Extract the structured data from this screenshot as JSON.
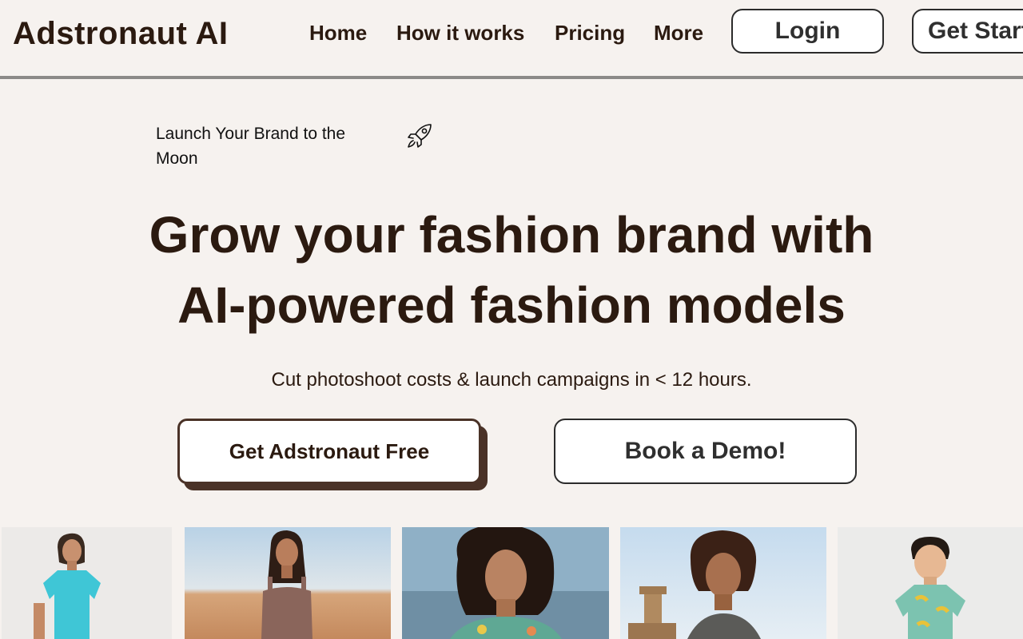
{
  "header": {
    "logo": "Adstronaut AI",
    "nav": [
      "Home",
      "How it works",
      "Pricing",
      "More"
    ],
    "login_label": "Login",
    "get_started_label": "Get Started"
  },
  "hero": {
    "tagline": "Launch Your Brand to the Moon",
    "tagline_icon": "rocket-icon",
    "headline_line1": "Grow your fashion brand with",
    "headline_line2": "AI-powered fashion models",
    "subheadline": "Cut photoshoot costs & launch campaigns in < 12 hours.",
    "primary_cta": "Get Adstronaut Free",
    "secondary_cta": "Book a Demo!"
  },
  "gallery": {
    "images": [
      "model-light-blue-tshirt",
      "model-desert-brown-top",
      "model-curly-hair-print-shirt",
      "model-ruins-curly-hair",
      "boy-banana-print-shirt"
    ]
  },
  "colors": {
    "background": "#f6f2ef",
    "text_primary": "#2b1a10",
    "button_shadow": "#4a3227"
  }
}
